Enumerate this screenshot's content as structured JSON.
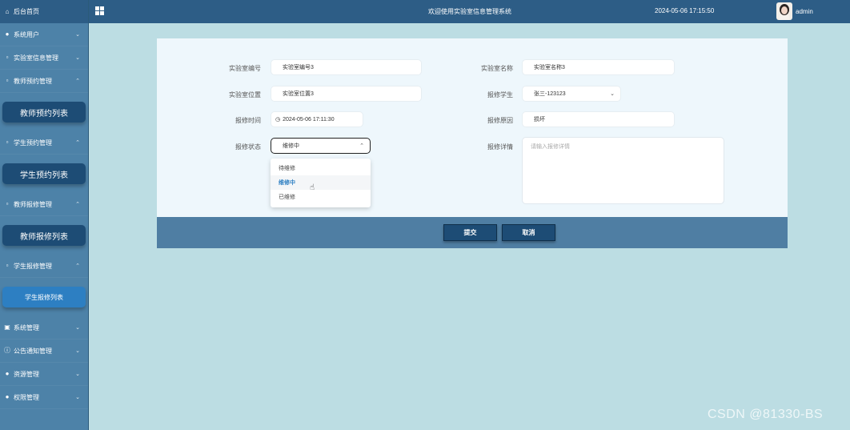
{
  "sidebar": {
    "home": "后台首页",
    "items": [
      {
        "label": "系统用户",
        "chev": "⌄"
      },
      {
        "label": "实验室信息管理",
        "chev": "⌄"
      },
      {
        "label": "教师预约管理",
        "chev": "⌃",
        "sub": "教师预约列表"
      },
      {
        "label": "学生预约管理",
        "chev": "⌃",
        "sub": "学生预约列表"
      },
      {
        "label": "教师报修管理",
        "chev": "⌃",
        "sub": "教师报修列表"
      },
      {
        "label": "学生报修管理",
        "chev": "⌃",
        "sub": "学生报修列表"
      },
      {
        "label": "系统管理",
        "chev": "⌄"
      },
      {
        "label": "公告通知管理",
        "chev": "⌄"
      },
      {
        "label": "资源管理",
        "chev": "⌄"
      },
      {
        "label": "权限管理",
        "chev": "⌄"
      }
    ]
  },
  "topbar": {
    "welcome": "欢迎使用实验室信息管理系统",
    "datetime": "2024-05-06 17:15:50",
    "user": "admin"
  },
  "form": {
    "lab_no_label": "实验室编号",
    "lab_no_value": "实验室编号3",
    "lab_name_label": "实验室名称",
    "lab_name_value": "实验室名称3",
    "lab_loc_label": "实验室位置",
    "lab_loc_value": "实验室位置3",
    "student_label": "报修学生",
    "student_value": "张三-123123",
    "time_label": "报修时间",
    "time_value": "2024-05-06 17:11:30",
    "reason_label": "报修原因",
    "reason_value": "损坏",
    "status_label": "报修状态",
    "status_value": "维修中",
    "detail_label": "报修详情",
    "detail_placeholder": "请输入报修详情",
    "status_options": [
      "待维修",
      "维修中",
      "已维修"
    ],
    "submit": "提交",
    "cancel": "取消"
  },
  "watermark": "CSDN @81330-BS"
}
